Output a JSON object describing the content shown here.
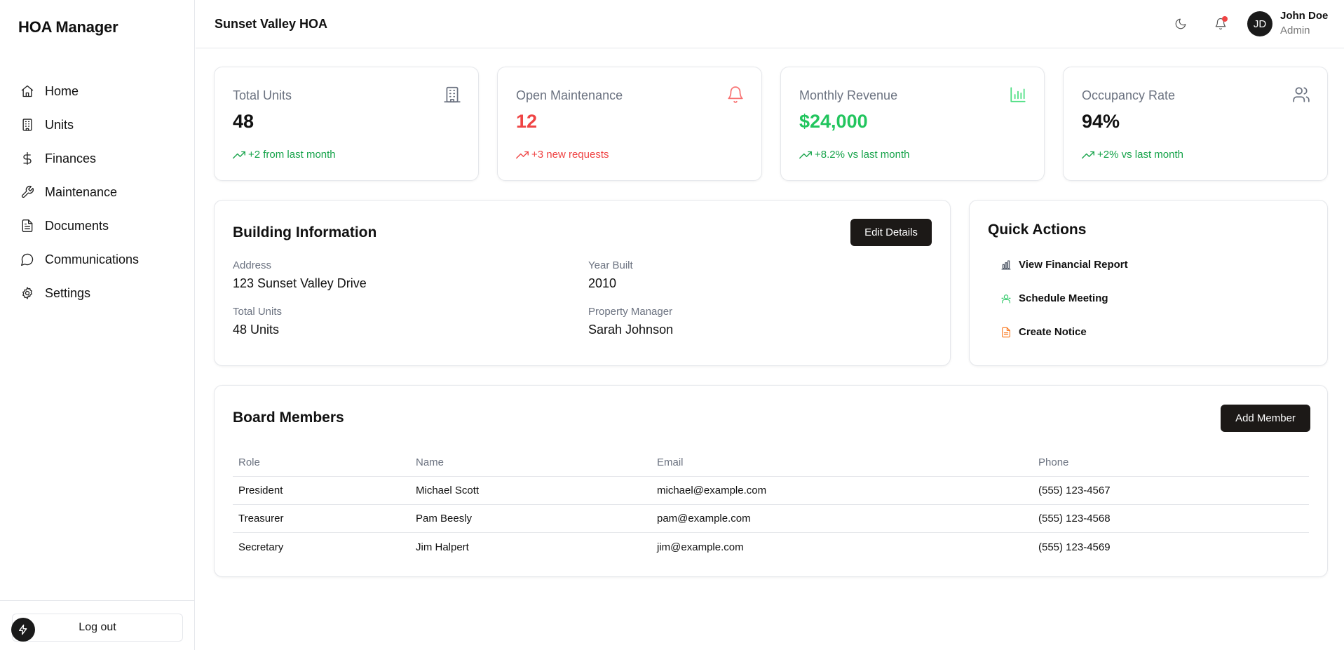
{
  "app": {
    "brand": "HOA Manager",
    "logout_label": "Log out"
  },
  "sidebar": {
    "items": [
      {
        "label": "Home",
        "icon": "home-icon"
      },
      {
        "label": "Units",
        "icon": "building-icon"
      },
      {
        "label": "Finances",
        "icon": "dollar-icon"
      },
      {
        "label": "Maintenance",
        "icon": "wrench-icon"
      },
      {
        "label": "Documents",
        "icon": "document-icon"
      },
      {
        "label": "Communications",
        "icon": "chat-icon"
      },
      {
        "label": "Settings",
        "icon": "gear-icon"
      }
    ]
  },
  "header": {
    "title": "Sunset Valley HOA",
    "user": {
      "initials": "JD",
      "name": "John Doe",
      "role": "Admin"
    }
  },
  "stats": [
    {
      "label": "Total Units",
      "value": "48",
      "trend": "+2 from last month",
      "icon": "building-icon",
      "value_color": "#111111",
      "trend_color": "#16a34a",
      "icon_color": "#6b7280"
    },
    {
      "label": "Open Maintenance",
      "value": "12",
      "trend": "+3 new requests",
      "icon": "bell-icon",
      "value_color": "#ef4444",
      "trend_color": "#ef4444",
      "icon_color": "#f87171"
    },
    {
      "label": "Monthly Revenue",
      "value": "$24,000",
      "trend": "+8.2% vs last month",
      "icon": "bar-chart-icon",
      "value_color": "#22c55e",
      "trend_color": "#16a34a",
      "icon_color": "#4ade80"
    },
    {
      "label": "Occupancy Rate",
      "value": "94%",
      "trend": "+2% vs last month",
      "icon": "users-icon",
      "value_color": "#111111",
      "trend_color": "#16a34a",
      "icon_color": "#6b7280"
    }
  ],
  "building": {
    "title": "Building Information",
    "edit_label": "Edit Details",
    "address_label": "Address",
    "address": "123 Sunset Valley Drive",
    "year_label": "Year Built",
    "year": "2010",
    "units_label": "Total Units",
    "units": "48 Units",
    "manager_label": "Property Manager",
    "manager": "Sarah Johnson"
  },
  "quick_actions": {
    "title": "Quick Actions",
    "items": [
      {
        "label": "View Financial Report",
        "icon": "bar-chart-icon",
        "color": "#374151"
      },
      {
        "label": "Schedule Meeting",
        "icon": "users-icon",
        "color": "#22c55e"
      },
      {
        "label": "Create Notice",
        "icon": "document-icon",
        "color": "#f97316"
      }
    ]
  },
  "board": {
    "title": "Board Members",
    "add_label": "Add Member",
    "columns": [
      "Role",
      "Name",
      "Email",
      "Phone"
    ],
    "rows": [
      [
        "President",
        "Michael Scott",
        "michael@example.com",
        "(555) 123-4567"
      ],
      [
        "Treasurer",
        "Pam Beesly",
        "pam@example.com",
        "(555) 123-4568"
      ],
      [
        "Secretary",
        "Jim Halpert",
        "jim@example.com",
        "(555) 123-4569"
      ]
    ]
  }
}
